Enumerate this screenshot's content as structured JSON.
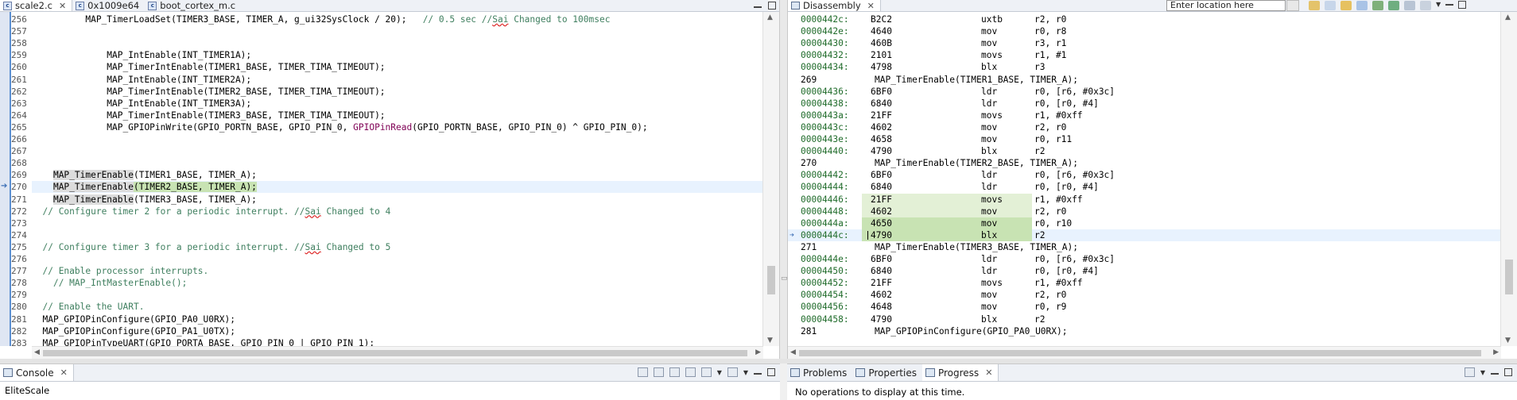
{
  "editor": {
    "tabs": [
      {
        "label": "scale2.c",
        "active": true,
        "icon": "c-file-icon"
      },
      {
        "label": "0x1009e64",
        "active": false,
        "icon": "c-file-icon"
      },
      {
        "label": "boot_cortex_m.c",
        "active": false,
        "icon": "c-file-icon"
      }
    ],
    "lines": [
      {
        "n": "256",
        "html": "          MAP_TimerLoadSet(TIMER3_BASE, TIMER_A, g_ui32SysClock / 20);   <span class=\"cm\">// 0.5 sec //<span class=\"sq\">Sai</span> Changed to 100msec</span>"
      },
      {
        "n": "257",
        "html": ""
      },
      {
        "n": "258",
        "html": ""
      },
      {
        "n": "259",
        "html": "              MAP_IntEnable(INT_TIMER1A);"
      },
      {
        "n": "260",
        "html": "              MAP_TimerIntEnable(TIMER1_BASE, TIMER_TIMA_TIMEOUT);"
      },
      {
        "n": "261",
        "html": "              MAP_IntEnable(INT_TIMER2A);"
      },
      {
        "n": "262",
        "html": "              MAP_TimerIntEnable(TIMER2_BASE, TIMER_TIMA_TIMEOUT);"
      },
      {
        "n": "263",
        "html": "              MAP_IntEnable(INT_TIMER3A);"
      },
      {
        "n": "264",
        "html": "              MAP_TimerIntEnable(TIMER3_BASE, TIMER_TIMA_TIMEOUT);"
      },
      {
        "n": "265",
        "html": "              MAP_GPIOPinWrite(GPIO_PORTN_BASE, GPIO_PIN_0, <span class=\"fn-purple\">GPIOPinRead</span>(GPIO_PORTN_BASE, GPIO_PIN_0) ^ GPIO_PIN_0);"
      },
      {
        "n": "266",
        "html": ""
      },
      {
        "n": "267",
        "html": ""
      },
      {
        "n": "268",
        "html": ""
      },
      {
        "n": "269",
        "html": "    <span class=\"hl-word\">MAP_TimerEnable</span>(TIMER1_BASE, TIMER_A);"
      },
      {
        "n": "270",
        "html": "    <span class=\"marked\"><span class=\"hl-word\">MAP_TimerEnable</span>(TIMER2_BASE, TIMER_A);</span>",
        "current": true
      },
      {
        "n": "271",
        "html": "    <span class=\"hl-word\">MAP_TimerEnable</span>(TIMER3_BASE, TIMER_A);"
      },
      {
        "n": "272",
        "html": "  <span class=\"cm\">// Configure timer 2 for a periodic interrupt. //<span class=\"sq\">Sai</span> Changed to 4</span>"
      },
      {
        "n": "273",
        "html": ""
      },
      {
        "n": "274",
        "html": ""
      },
      {
        "n": "275",
        "html": "  <span class=\"cm\">// Configure timer 3 for a periodic interrupt. //<span class=\"sq\">Sai</span> Changed to 5</span>"
      },
      {
        "n": "276",
        "html": ""
      },
      {
        "n": "277",
        "html": "  <span class=\"cm\">// Enable processor interrupts.</span>"
      },
      {
        "n": "278",
        "html": "    <span class=\"cm\">// MAP_IntMasterEnable();</span>"
      },
      {
        "n": "279",
        "html": ""
      },
      {
        "n": "280",
        "html": "  <span class=\"cm\">// Enable the UART.</span>"
      },
      {
        "n": "281",
        "html": "  MAP_GPIOPinConfigure(GPIO_PA0_U0RX);"
      },
      {
        "n": "282",
        "html": "  MAP_GPIOPinConfigure(GPIO_PA1_U0TX);"
      },
      {
        "n": "283",
        "html": "  MAP_GPIOPinTypeUART(GPIO_PORTA_BASE, GPIO_PIN_0 | GPIO_PIN_1);"
      }
    ]
  },
  "disassembly": {
    "tab_label": "Disassembly",
    "location_placeholder": "Enter location here",
    "rows": [
      {
        "type": "ins",
        "addr": "0000442c:",
        "hex": "B2C2",
        "mn": "uxtb",
        "ops": "r2, r0"
      },
      {
        "type": "ins",
        "addr": "0000442e:",
        "hex": "4640",
        "mn": "mov",
        "ops": "r0, r8"
      },
      {
        "type": "ins",
        "addr": "00004430:",
        "hex": "460B",
        "mn": "mov",
        "ops": "r3, r1"
      },
      {
        "type": "ins",
        "addr": "00004432:",
        "hex": "2101",
        "mn": "movs",
        "ops": "r1, #1"
      },
      {
        "type": "ins",
        "addr": "00004434:",
        "hex": "4798",
        "mn": "blx",
        "ops": "r3"
      },
      {
        "type": "src",
        "ln": "269",
        "src": "MAP_TimerEnable(TIMER1_BASE, TIMER_A);"
      },
      {
        "type": "ins",
        "addr": "00004436:",
        "hex": "6BF0",
        "mn": "ldr",
        "ops": "r0, [r6, #0x3c]"
      },
      {
        "type": "ins",
        "addr": "00004438:",
        "hex": "6840",
        "mn": "ldr",
        "ops": "r0, [r0, #4]"
      },
      {
        "type": "ins",
        "addr": "0000443a:",
        "hex": "21FF",
        "mn": "movs",
        "ops": "r1, #0xff"
      },
      {
        "type": "ins",
        "addr": "0000443c:",
        "hex": "4602",
        "mn": "mov",
        "ops": "r2, r0"
      },
      {
        "type": "ins",
        "addr": "0000443e:",
        "hex": "4658",
        "mn": "mov",
        "ops": "r0, r11"
      },
      {
        "type": "ins",
        "addr": "00004440:",
        "hex": "4790",
        "mn": "blx",
        "ops": "r2"
      },
      {
        "type": "src",
        "ln": "270",
        "src": "MAP_TimerEnable(TIMER2_BASE, TIMER_A);"
      },
      {
        "type": "ins",
        "addr": "00004442:",
        "hex": "6BF0",
        "mn": "ldr",
        "ops": "r0, [r6, #0x3c]"
      },
      {
        "type": "ins",
        "addr": "00004444:",
        "hex": "6840",
        "mn": "ldr",
        "ops": "r0, [r0, #4]"
      },
      {
        "type": "ins",
        "addr": "00004446:",
        "hex": "21FF",
        "mn": "movs",
        "ops": "r1, #0xff",
        "mark": "light"
      },
      {
        "type": "ins",
        "addr": "00004448:",
        "hex": "4602",
        "mn": "mov",
        "ops": "r2, r0",
        "mark": "light"
      },
      {
        "type": "ins",
        "addr": "0000444a:",
        "hex": "4650",
        "mn": "mov",
        "ops": "r0, r10",
        "mark": "dark"
      },
      {
        "type": "ins",
        "addr": "0000444c:",
        "hex": "4790",
        "mn": "blx",
        "ops": "r2",
        "mark": "dark",
        "current": true
      },
      {
        "type": "src",
        "ln": "271",
        "src": "MAP_TimerEnable(TIMER3_BASE, TIMER_A);"
      },
      {
        "type": "ins",
        "addr": "0000444e:",
        "hex": "6BF0",
        "mn": "ldr",
        "ops": "r0, [r6, #0x3c]"
      },
      {
        "type": "ins",
        "addr": "00004450:",
        "hex": "6840",
        "mn": "ldr",
        "ops": "r0, [r0, #4]"
      },
      {
        "type": "ins",
        "addr": "00004452:",
        "hex": "21FF",
        "mn": "movs",
        "ops": "r1, #0xff"
      },
      {
        "type": "ins",
        "addr": "00004454:",
        "hex": "4602",
        "mn": "mov",
        "ops": "r2, r0"
      },
      {
        "type": "ins",
        "addr": "00004456:",
        "hex": "4648",
        "mn": "mov",
        "ops": "r0, r9"
      },
      {
        "type": "ins",
        "addr": "00004458:",
        "hex": "4790",
        "mn": "blx",
        "ops": "r2"
      },
      {
        "type": "src",
        "ln": "281",
        "src": "MAP_GPIOPinConfigure(GPIO_PA0_U0RX);"
      }
    ]
  },
  "console": {
    "tab_label": "Console",
    "text": "EliteScale"
  },
  "progress": {
    "tabs": [
      {
        "label": "Problems",
        "active": false
      },
      {
        "label": "Properties",
        "active": false
      },
      {
        "label": "Progress",
        "active": true
      }
    ],
    "text": "No operations to display at this time."
  },
  "colors": {
    "marked_line": "#c8e3b3",
    "current_line": "#e8f2fe",
    "comment": "#3f7f5f",
    "address": "#1f6b2a"
  }
}
